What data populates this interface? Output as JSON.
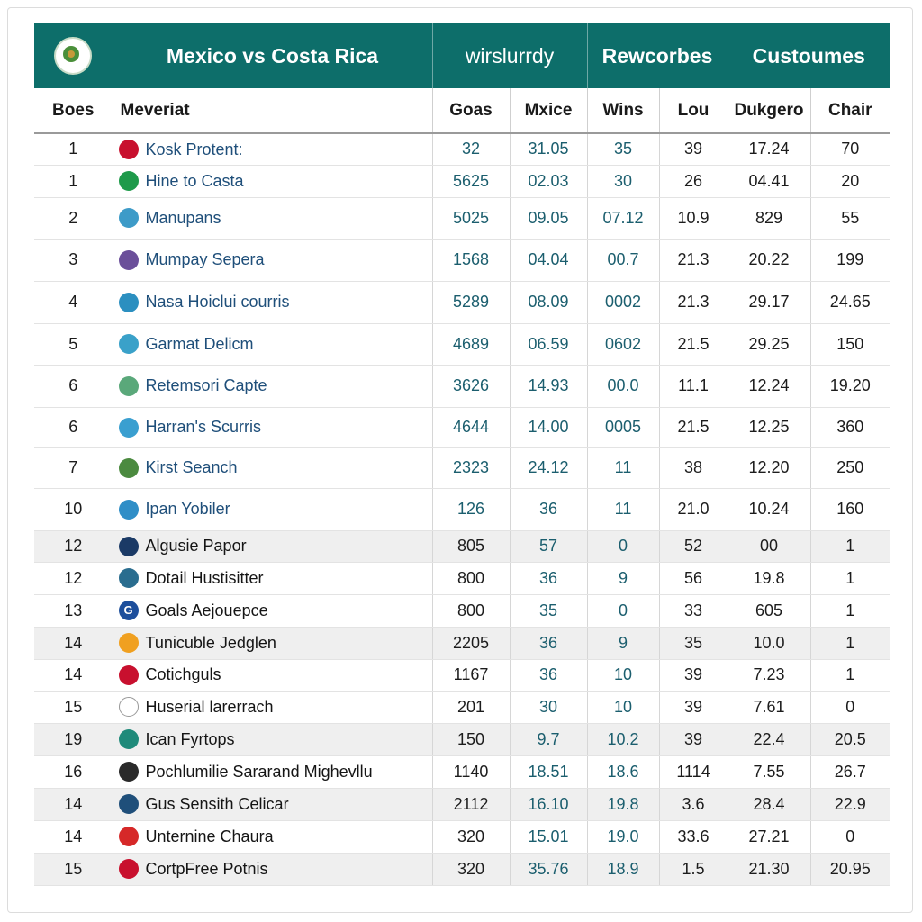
{
  "header": {
    "title": "Mexico vs Costa Rica",
    "group_a": "wirslurrdy",
    "group_b": "Rewcorbes",
    "group_c": "Custoumes"
  },
  "columns": [
    "Boes",
    "Meveriat",
    "Goas",
    "Mxice",
    "Wins",
    "Lou",
    "Dukgero",
    "Chair"
  ],
  "rows": [
    {
      "rank": "1",
      "name": "Kosk Protent:",
      "goals": "32",
      "mxice": "31.05",
      "wins": "35",
      "lou": "39",
      "dukgero": "17.24",
      "chair": "70",
      "icon": "mexico-flag-icon",
      "color": "#c8102e",
      "style": "blue"
    },
    {
      "rank": "1",
      "name": "Hine to Casta",
      "goals": "5625",
      "mxice": "02.03",
      "wins": "30",
      "lou": "26",
      "dukgero": "04.41",
      "chair": "20",
      "icon": "figure-icon",
      "color": "#1e9a4a",
      "style": "blue"
    },
    {
      "rank": "2",
      "name": "Manupans",
      "goals": "5025",
      "mxice": "09.05",
      "wins": "07.12",
      "lou": "10.9",
      "dukgero": "829",
      "chair": "55",
      "icon": "team-crest-icon",
      "color": "#3d9bc8",
      "style": "blue"
    },
    {
      "rank": "3",
      "name": "Mumpay Sepera",
      "goals": "1568",
      "mxice": "04.04",
      "wins": "00.7",
      "lou": "21.3",
      "dukgero": "20.22",
      "chair": "199",
      "icon": "team-crest-icon",
      "color": "#6b4f9a",
      "style": "blue"
    },
    {
      "rank": "4",
      "name": "Nasa Hoiclui courris",
      "goals": "5289",
      "mxice": "08.09",
      "wins": "0002",
      "lou": "21.3",
      "dukgero": "29.17",
      "chair": "24.65",
      "icon": "team-crest-icon",
      "color": "#2b8fc0",
      "style": "blue"
    },
    {
      "rank": "5",
      "name": "Garmat Delicm",
      "goals": "4689",
      "mxice": "06.59",
      "wins": "0602",
      "lou": "21.5",
      "dukgero": "29.25",
      "chair": "150",
      "icon": "team-crest-icon",
      "color": "#3aa1c9",
      "style": "blue"
    },
    {
      "rank": "6",
      "name": "Retemsori Capte",
      "goals": "3626",
      "mxice": "14.93",
      "wins": "00.0",
      "lou": "11.1",
      "dukgero": "12.24",
      "chair": "19.20",
      "icon": "team-crest-icon",
      "color": "#5aa87a",
      "style": "blue"
    },
    {
      "rank": "6",
      "name": "Harran's Scurris",
      "goals": "4644",
      "mxice": "14.00",
      "wins": "0005",
      "lou": "21.5",
      "dukgero": "12.25",
      "chair": "360",
      "icon": "team-crest-icon",
      "color": "#3a9fd0",
      "style": "blue"
    },
    {
      "rank": "7",
      "name": "Kirst Seanch",
      "goals": "2323",
      "mxice": "24.12",
      "wins": "11",
      "lou": "38",
      "dukgero": "12.20",
      "chair": "250",
      "icon": "team-crest-icon",
      "color": "#4b8a3f",
      "style": "blue"
    },
    {
      "rank": "10",
      "name": "Ipan Yobiler",
      "goals": "126",
      "mxice": "36",
      "wins": "11",
      "lou": "21.0",
      "dukgero": "10.24",
      "chair": "160",
      "icon": "team-crest-icon",
      "color": "#2f8ec7",
      "style": "blue"
    },
    {
      "rank": "12",
      "name": "Algusie Papor",
      "goals": "805",
      "mxice": "57",
      "wins": "0",
      "lou": "52",
      "dukgero": "00",
      "chair": "1",
      "icon": "team-crest-icon",
      "color": "#1b3a66",
      "style": "dark",
      "shade": true
    },
    {
      "rank": "12",
      "name": "Dotail Hustisitter",
      "goals": "800",
      "mxice": "36",
      "wins": "9",
      "lou": "56",
      "dukgero": "19.8",
      "chair": "1",
      "icon": "team-crest-icon",
      "color": "#2a6d8f",
      "style": "dark"
    },
    {
      "rank": "13",
      "name": "Goals Aejouepce",
      "goals": "800",
      "mxice": "35",
      "wins": "0",
      "lou": "33",
      "dukgero": "605",
      "chair": "1",
      "icon": "g-logo-icon",
      "color": "#1d4f9c",
      "style": "dark"
    },
    {
      "rank": "14",
      "name": "Tunicuble Jedglen",
      "goals": "2205",
      "mxice": "36",
      "wins": "9",
      "lou": "35",
      "dukgero": "10.0",
      "chair": "1",
      "icon": "team-crest-icon",
      "color": "#f0a020",
      "style": "dark",
      "shade": true
    },
    {
      "rank": "14",
      "name": "Cotichguls",
      "goals": "1167",
      "mxice": "36",
      "wins": "10",
      "lou": "39",
      "dukgero": "7.23",
      "chair": "1",
      "icon": "team-crest-icon",
      "color": "#c8102e",
      "style": "dark"
    },
    {
      "rank": "15",
      "name": "Huserial larerrach",
      "goals": "201",
      "mxice": "30",
      "wins": "10",
      "lou": "39",
      "dukgero": "7.61",
      "chair": "0",
      "icon": "figure-icon",
      "color": "#ffffff",
      "style": "dark"
    },
    {
      "rank": "19",
      "name": "Ican Fyrtops",
      "goals": "150",
      "mxice": "9.7",
      "wins": "10.2",
      "lou": "39",
      "dukgero": "22.4",
      "chair": "20.5",
      "icon": "team-crest-icon",
      "color": "#1f8a7a",
      "style": "dark",
      "shade": true
    },
    {
      "rank": "16",
      "name": "Pochlumilie Sararand Mighevllu",
      "goals": "1140",
      "mxice": "18.51",
      "wins": "18.6",
      "lou": "1114",
      "dukgero": "7.55",
      "chair": "26.7",
      "icon": "soccer-ball-icon",
      "color": "#2a2a2a",
      "style": "dark"
    },
    {
      "rank": "14",
      "name": "Gus Sensith Celicar",
      "goals": "2112",
      "mxice": "16.10",
      "wins": "19.8",
      "lou": "3.6",
      "dukgero": "28.4",
      "chair": "22.9",
      "icon": "team-crest-icon",
      "color": "#1f4f7a",
      "style": "dark",
      "shade": true
    },
    {
      "rank": "14",
      "name": "Unternine Chaura",
      "goals": "320",
      "mxice": "15.01",
      "wins": "19.0",
      "lou": "33.6",
      "dukgero": "27.21",
      "chair": "0",
      "icon": "flag-icon",
      "color": "#d62828",
      "style": "dark"
    },
    {
      "rank": "15",
      "name": "CortpFree Potnis",
      "goals": "320",
      "mxice": "35.76",
      "wins": "18.9",
      "lou": "1.5",
      "dukgero": "21.30",
      "chair": "20.95",
      "icon": "mexico-flag-icon",
      "color": "#c8102e",
      "style": "dark",
      "shade": true
    }
  ]
}
